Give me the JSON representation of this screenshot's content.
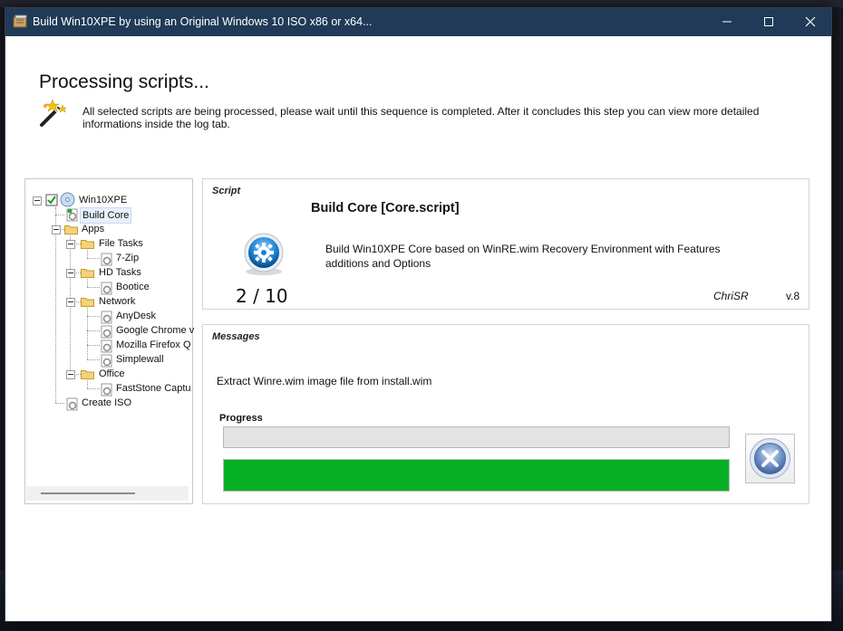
{
  "window": {
    "title": "Build Win10XPE by using an Original Windows 10 ISO x86 or x64...",
    "minimize_icon": "minimize-icon",
    "maximize_icon": "maximize-icon",
    "close_icon": "close-icon",
    "titlebar_color": "#203a57"
  },
  "header": {
    "title": "Processing scripts...",
    "description": "All selected scripts are being processed, please wait until this sequence is completed. After it concludes this step you can view more detailed informations inside the log tab.",
    "icon": "magic-wand-icon"
  },
  "tree": {
    "root": "Win10XPE",
    "items": {
      "build_core": "Build Core",
      "apps": "Apps",
      "file_tasks": "File Tasks",
      "zip": "7-Zip",
      "hd_tasks": "HD Tasks",
      "bootice": "Bootice",
      "network": "Network",
      "anydesk": "AnyDesk",
      "chrome": "Google Chrome v",
      "firefox": "Mozilla Firefox Q",
      "simplewall": "Simplewall",
      "office": "Office",
      "faststone": "FastStone Captu",
      "create_iso": "Create ISO"
    },
    "selected": "Build Core"
  },
  "script": {
    "group_label": "Script",
    "name": "Build Core [Core.script]",
    "description": "Build Win10XPE Core based on WinRE.wim Recovery Environment with Features additions and Options",
    "counter": "2 / 10",
    "author": "ChriSR",
    "version": "v.8",
    "icon": "gear-script-icon"
  },
  "messages": {
    "group_label": "Messages",
    "text": "Extract Winre.wim image file from install.wim",
    "progress_label": "Progress",
    "script_progress": 0.0,
    "overall_progress": 1.0,
    "progress_color": "#06b025",
    "cancel_icon": "cancel-x-icon"
  }
}
